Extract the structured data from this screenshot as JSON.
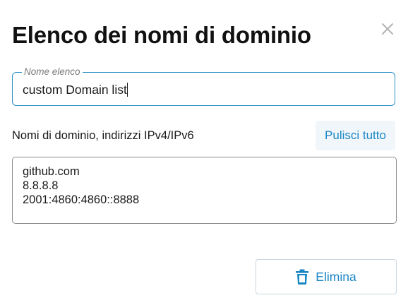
{
  "dialog": {
    "title": "Elenco dei nomi di dominio",
    "close_icon": "close-icon"
  },
  "list_name": {
    "label": "Nome elenco",
    "value": "custom Domain list"
  },
  "domains": {
    "label": "Nomi di dominio, indirizzi IPv4/IPv6",
    "clear_all_label": "Pulisci tutto",
    "entries": [
      "github.com",
      "8.8.8.8",
      "2001:4860:4860::8888"
    ]
  },
  "actions": {
    "delete_label": "Elimina",
    "delete_icon": "trash-icon"
  },
  "colors": {
    "accent": "#1a86c4",
    "field_border": "#2a8fc4",
    "clear_bg": "#f1f6fa"
  }
}
